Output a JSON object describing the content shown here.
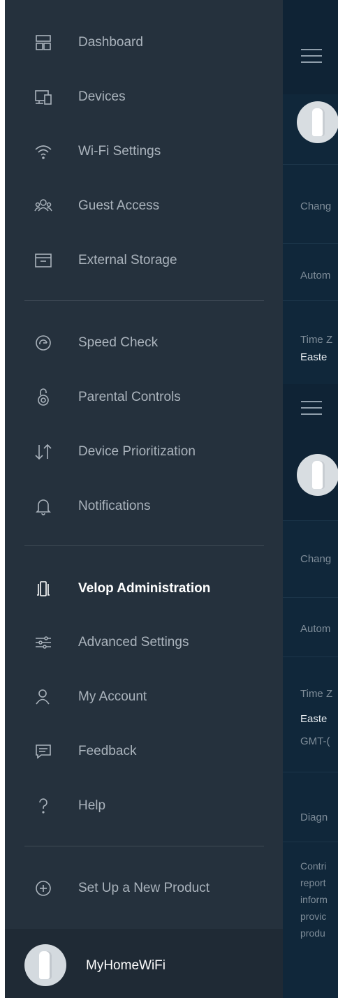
{
  "nav": {
    "items": [
      {
        "label": "Dashboard",
        "icon": "dashboard-icon"
      },
      {
        "label": "Devices",
        "icon": "devices-icon"
      },
      {
        "label": "Wi-Fi Settings",
        "icon": "wifi-icon"
      },
      {
        "label": "Guest Access",
        "icon": "guest-access-icon"
      },
      {
        "label": "External Storage",
        "icon": "external-storage-icon"
      },
      {
        "label": "Speed Check",
        "icon": "speed-check-icon"
      },
      {
        "label": "Parental Controls",
        "icon": "parental-controls-icon"
      },
      {
        "label": "Device Prioritization",
        "icon": "device-prioritization-icon"
      },
      {
        "label": "Notifications",
        "icon": "notifications-icon"
      },
      {
        "label": "Velop Administration",
        "icon": "velop-administration-icon",
        "active": true
      },
      {
        "label": "Advanced Settings",
        "icon": "advanced-settings-icon"
      },
      {
        "label": "My Account",
        "icon": "my-account-icon"
      },
      {
        "label": "Feedback",
        "icon": "feedback-icon"
      },
      {
        "label": "Help",
        "icon": "help-icon"
      },
      {
        "label": "Set Up a New Product",
        "icon": "add-product-icon"
      }
    ]
  },
  "profile": {
    "name": "MyHomeWiFi"
  },
  "background_pane": {
    "top_section": [
      "Chang",
      "Autom",
      "Time Z",
      "Easte"
    ],
    "bottom_section": [
      "Chang",
      "Autom",
      "Time Z",
      "Easte",
      "GMT-(",
      "Diagn",
      "Contri",
      "report",
      "inform",
      "provic",
      "produ"
    ]
  },
  "colors": {
    "drawer_bg": "#25313d",
    "pane_bg": "#10273a",
    "label": "#aab3bc",
    "active_label": "#ffffff"
  }
}
